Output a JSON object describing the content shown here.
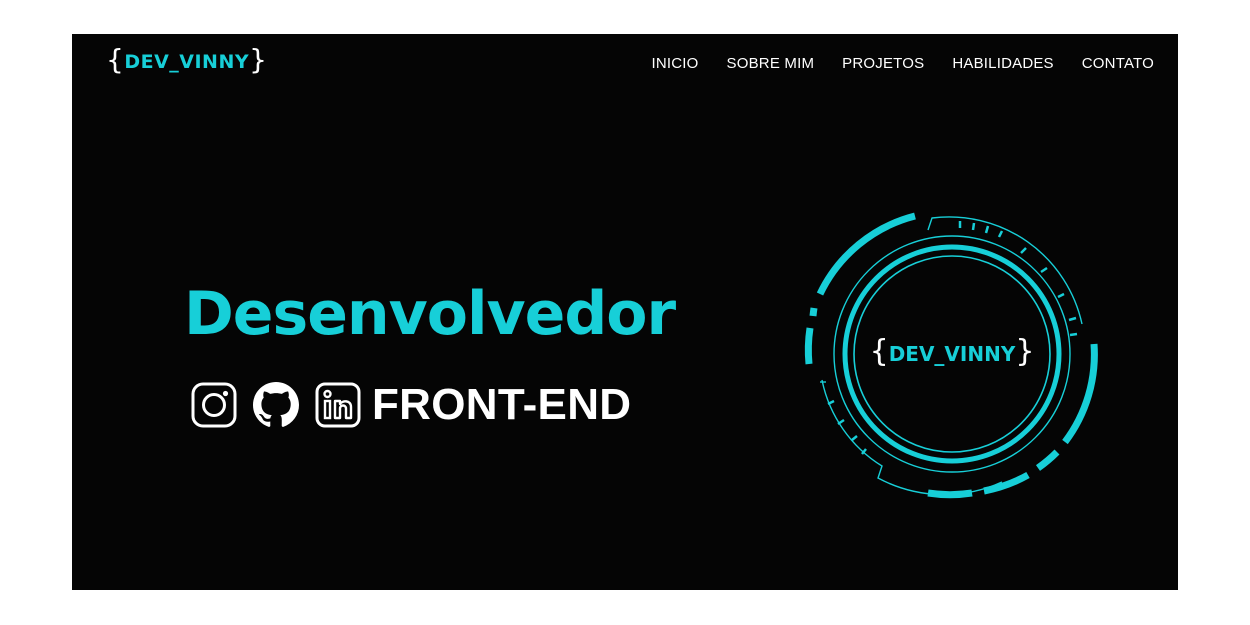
{
  "brand": {
    "open_brace": "{",
    "name": "DEV_VINNY",
    "close_brace": "}"
  },
  "nav": {
    "items": [
      "INICIO",
      "SOBRE MIM",
      "PROJETOS",
      "HABILIDADES",
      "CONTATO"
    ]
  },
  "hero": {
    "title": "Desenvolvedor",
    "role": "FRONT-END",
    "social_icons": [
      "instagram-icon",
      "github-icon",
      "linkedin-icon"
    ]
  },
  "hud_logo": {
    "open_brace": "{",
    "name": "DEV_VINNY",
    "close_brace": "}"
  },
  "colors": {
    "accent": "#17cfd8",
    "background": "#050505",
    "text": "#ffffff"
  }
}
